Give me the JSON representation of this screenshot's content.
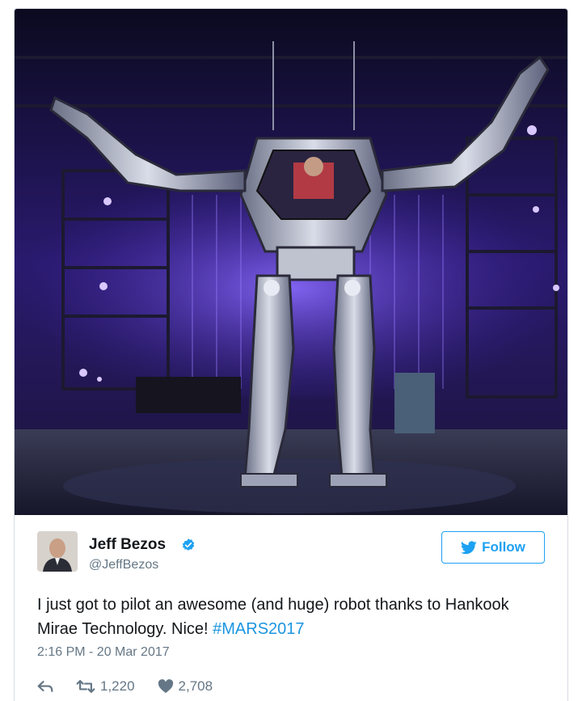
{
  "tweet": {
    "author_name": "Jeff Bezos",
    "handle": "@JeffBezos",
    "follow_label": "Follow",
    "text_main": "I just got to pilot an awesome (and huge) robot thanks to Hankook Mirae Technology. Nice! ",
    "hashtag": "#MARS2017",
    "timestamp": "2:16 PM - 20 Mar 2017",
    "retweets": "1,220",
    "likes": "2,708"
  },
  "colors": {
    "accent": "#1da1f2",
    "stage_purple": "#6b3cff"
  },
  "icons": [
    "verified-badge-icon",
    "twitter-bird-icon",
    "reply-icon",
    "retweet-icon",
    "heart-icon"
  ]
}
